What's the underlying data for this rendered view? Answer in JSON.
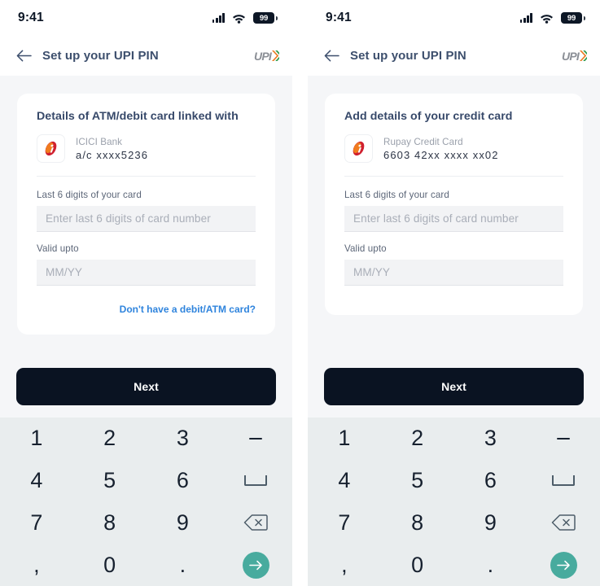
{
  "status_bar": {
    "time": "9:41",
    "battery_level": "99",
    "signal_icon": "cellular-signal-icon",
    "wifi_icon": "wifi-icon",
    "battery_icon": "battery-icon"
  },
  "app_bar": {
    "back_icon": "back-arrow-icon",
    "title": "Set up your UPI PIN",
    "logo_text": "UPI",
    "logo_icon": "upi-logo-icon"
  },
  "colors": {
    "accent_teal": "#48ab9e",
    "link_blue": "#2f84dd",
    "button_dark": "#0a1322",
    "page_bg": "#f5f6f8",
    "keypad_bg": "#e9edee",
    "title_slate": "#3d4f6d"
  },
  "panels": [
    {
      "card": {
        "title": "Details of ATM/debit card linked with",
        "bank_logo_icon": "icici-bank-logo-icon",
        "bank_name": "ICICI Bank",
        "account_masked": "a/c xxxx5236",
        "fields": [
          {
            "label": "Last 6 digits of your card",
            "value": "",
            "placeholder": "Enter last 6 digits of card number"
          },
          {
            "label": "Valid upto",
            "value": "",
            "placeholder": "MM/YY"
          }
        ],
        "helper_link": "Don't have a debit/ATM card?"
      },
      "next_label": "Next"
    },
    {
      "card": {
        "title": "Add details of your credit card",
        "bank_logo_icon": "icici-bank-logo-icon",
        "bank_name": "Rupay Credit Card",
        "account_masked": "6603 42xx xxxx xx02",
        "fields": [
          {
            "label": "Last 6 digits of your card",
            "value": "",
            "placeholder": "Enter last 6 digits of card number"
          },
          {
            "label": "Valid upto",
            "value": "",
            "placeholder": "MM/YY"
          }
        ],
        "helper_link": null
      },
      "next_label": "Next"
    }
  ],
  "keypad": {
    "keys": [
      {
        "label": "1",
        "name": "key-1",
        "type": "digit"
      },
      {
        "label": "2",
        "name": "key-2",
        "type": "digit"
      },
      {
        "label": "3",
        "name": "key-3",
        "type": "digit"
      },
      {
        "label": "-",
        "name": "key-dash",
        "type": "dash"
      },
      {
        "label": "4",
        "name": "key-4",
        "type": "digit"
      },
      {
        "label": "5",
        "name": "key-5",
        "type": "digit"
      },
      {
        "label": "6",
        "name": "key-6",
        "type": "digit"
      },
      {
        "label": "",
        "name": "key-space",
        "type": "space"
      },
      {
        "label": "7",
        "name": "key-7",
        "type": "digit"
      },
      {
        "label": "8",
        "name": "key-8",
        "type": "digit"
      },
      {
        "label": "9",
        "name": "key-9",
        "type": "digit"
      },
      {
        "label": "",
        "name": "key-backspace",
        "type": "backspace"
      },
      {
        "label": ",",
        "name": "key-comma",
        "type": "digit"
      },
      {
        "label": "0",
        "name": "key-0",
        "type": "digit"
      },
      {
        "label": ".",
        "name": "key-period",
        "type": "digit"
      },
      {
        "label": "",
        "name": "key-submit",
        "type": "submit"
      }
    ]
  }
}
